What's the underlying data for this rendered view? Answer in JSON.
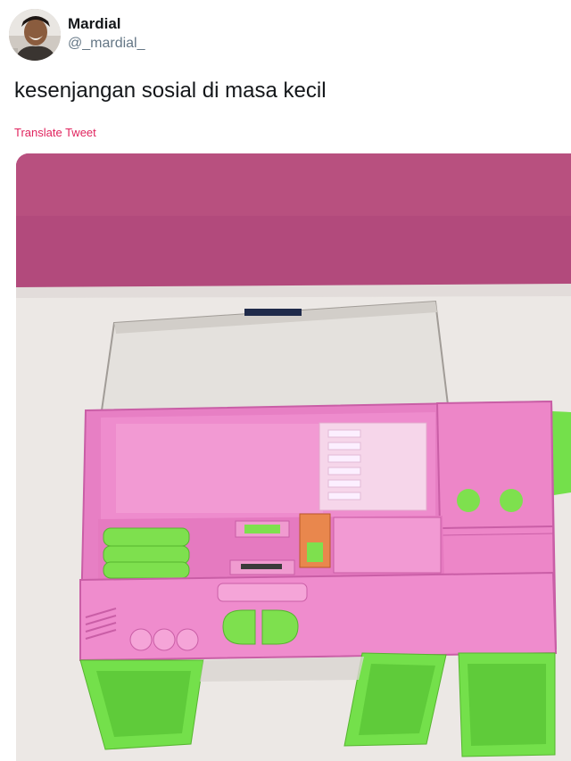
{
  "tweet": {
    "display_name": "Mardial",
    "handle": "@_mardial_",
    "text": "kesenjangan sosial di masa kecil",
    "translate_label": "Translate Tweet"
  },
  "icons": {
    "avatar": "user-avatar-photo"
  },
  "colors": {
    "link": "#e0245e",
    "handle": "#657786",
    "text": "#14171a"
  }
}
